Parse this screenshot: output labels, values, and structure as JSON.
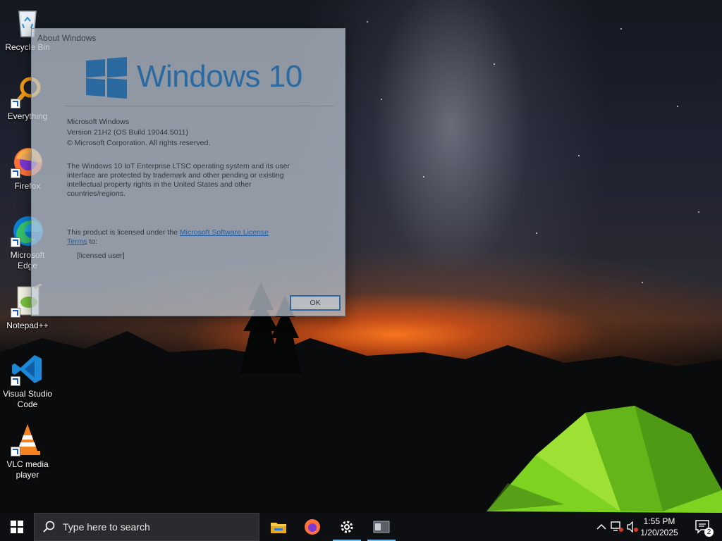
{
  "desktop": {
    "icons": [
      {
        "label": "Recycle Bin"
      },
      {
        "label": "Everything"
      },
      {
        "label": "Firefox"
      },
      {
        "label": "Microsoft Edge"
      },
      {
        "label": "Notepad++"
      },
      {
        "label": "Visual Studio Code"
      },
      {
        "label": "VLC media player"
      }
    ]
  },
  "dialog": {
    "title": "About Windows",
    "logo_text": "Windows 10",
    "product": "Microsoft Windows",
    "version": "Version 21H2 (OS Build 19044.5011)",
    "copyright": "© Microsoft Corporation. All rights reserved.",
    "description": "The Windows 10 IoT Enterprise LTSC operating system and its user interface are protected by trademark and other pending or existing intellectual property rights in the United States and other countries/regions.",
    "license_prefix": "This product is licensed under the ",
    "license_link": "Microsoft Software License Terms",
    "license_suffix": " to:",
    "licensee": "[licensed user]",
    "ok_label": "OK"
  },
  "taskbar": {
    "search_placeholder": "Type here to search",
    "apps": [
      "file-explorer-icon",
      "firefox-icon",
      "settings-icon",
      "window-app-icon"
    ],
    "time": "1:55 PM",
    "date": "1/20/2025",
    "notification_count": "2"
  },
  "colors": {
    "accent": "#2b6aa1",
    "taskbar": "#0e0f12",
    "tent_green": "#7ed321"
  }
}
